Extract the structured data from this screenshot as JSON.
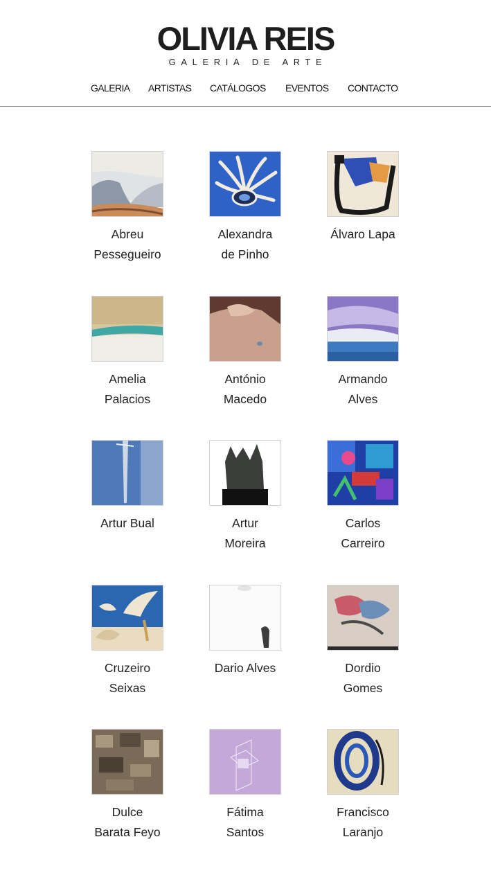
{
  "brand": {
    "title": "OLIVIA REIS",
    "subtitle": "GALERIA DE ARTE"
  },
  "nav": {
    "items": [
      {
        "label": "GALERIA"
      },
      {
        "label": "ARTISTAS"
      },
      {
        "label": "CATÁLOGOS"
      },
      {
        "label": "EVENTOS"
      },
      {
        "label": "CONTACTO"
      }
    ]
  },
  "artists": [
    {
      "line1": "Abreu",
      "line2": "Pessegueiro"
    },
    {
      "line1": "Alexandra",
      "line2": "de Pinho"
    },
    {
      "line1": "Álvaro Lapa",
      "line2": ""
    },
    {
      "line1": "Amelia",
      "line2": "Palacios"
    },
    {
      "line1": "António",
      "line2": "Macedo"
    },
    {
      "line1": "Armando",
      "line2": "Alves"
    },
    {
      "line1": "Artur Bual",
      "line2": ""
    },
    {
      "line1": "Artur",
      "line2": "Moreira"
    },
    {
      "line1": "Carlos",
      "line2": "Carreiro"
    },
    {
      "line1": "Cruzeiro",
      "line2": "Seixas"
    },
    {
      "line1": "Dario Alves",
      "line2": ""
    },
    {
      "line1": "Dordio",
      "line2": "Gomes"
    },
    {
      "line1": "Dulce",
      "line2": "Barata Feyo"
    },
    {
      "line1": "Fátima",
      "line2": "Santos"
    },
    {
      "line1": "Francisco",
      "line2": "Laranjo"
    }
  ]
}
